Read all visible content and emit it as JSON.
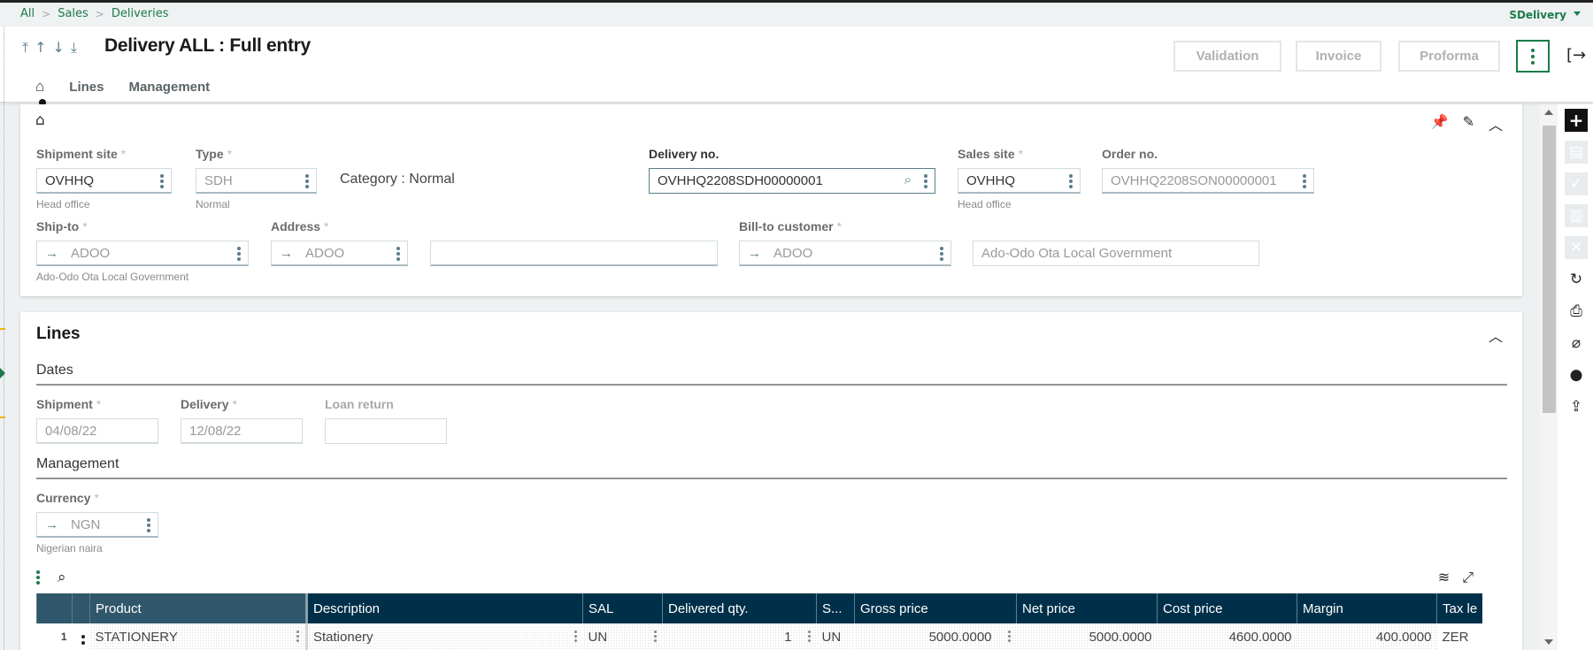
{
  "breadcrumb": [
    "All",
    "Sales",
    "Deliveries"
  ],
  "app_function": "SDelivery",
  "header": {
    "title": "Delivery ALL : Full entry",
    "nav_arrows": [
      "first-record",
      "previous-record",
      "next-record",
      "last-record"
    ],
    "buttons": {
      "validation": "Validation",
      "invoice": "Invoice",
      "proforma": "Proforma"
    },
    "tabs": [
      "Lines",
      "Management"
    ]
  },
  "header_section": {
    "shipment_site": {
      "label": "Shipment site",
      "value": "OVHHQ",
      "description": "Head office",
      "required": true
    },
    "type": {
      "label": "Type",
      "value": "SDH",
      "description": "Normal",
      "required": true
    },
    "category_text": "Category : Normal",
    "delivery_no": {
      "label": "Delivery no.",
      "value": "OVHHQ2208SDH00000001"
    },
    "sales_site": {
      "label": "Sales site",
      "value": "OVHHQ",
      "description": "Head office",
      "required": true
    },
    "order_no": {
      "label": "Order no.",
      "value": "OVHHQ2208SON00000001"
    },
    "ship_to": {
      "label": "Ship-to",
      "value": "ADOO",
      "description": "Ado-Odo Ota Local Government",
      "required": true
    },
    "address": {
      "label": "Address",
      "value": "ADOO",
      "extra_value": "",
      "required": true
    },
    "bill_to_customer": {
      "label": "Bill-to customer",
      "value": "ADOO",
      "name": "Ado-Odo Ota Local Government",
      "required": true
    }
  },
  "lines_section": {
    "title": "Lines",
    "dates": {
      "title": "Dates",
      "shipment": {
        "label": "Shipment",
        "value": "04/08/22",
        "required": true
      },
      "delivery": {
        "label": "Delivery",
        "value": "12/08/22",
        "required": true
      },
      "loan_return": {
        "label": "Loan return",
        "value": ""
      }
    },
    "management": {
      "title": "Management",
      "currency": {
        "label": "Currency",
        "value": "NGN",
        "description": "Nigerian naira",
        "required": true
      }
    },
    "grid": {
      "columns": [
        "",
        "",
        "Product",
        "Description",
        "SAL",
        "Delivered qty.",
        "S...",
        "Gross price",
        "Net price",
        "Cost price",
        "Margin",
        "Tax le"
      ],
      "rows": [
        {
          "num": "1",
          "product": "STATIONERY",
          "description": "Stationery",
          "sal": "UN",
          "delivered_qty": "1",
          "s": "UN",
          "gross_price": "5000.0000",
          "net_price": "5000.0000",
          "cost_price": "4600.0000",
          "margin": "400.0000",
          "tax_level": "ZER"
        }
      ]
    }
  },
  "right_rail": [
    "add",
    "save",
    "validate",
    "delete",
    "cancel",
    "refresh",
    "print",
    "attachment",
    "comment",
    "export"
  ],
  "colors": {
    "accent": "#1a7a4a",
    "grid_header": "#003049",
    "grid_header_fixed": "#30576b"
  }
}
